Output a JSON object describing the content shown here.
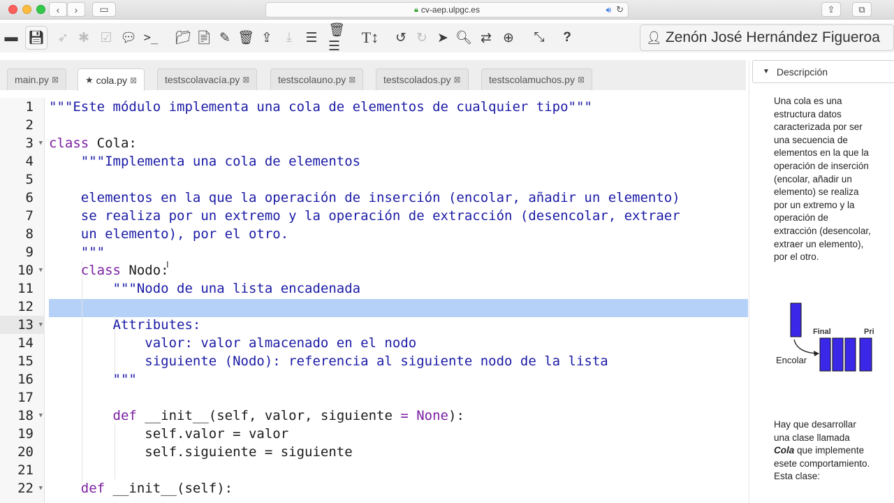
{
  "browser": {
    "url": "cv-aep.ulpgc.es"
  },
  "toolbar": {
    "user_name": "Zenón José Hernández Figueroa"
  },
  "tabs": [
    {
      "label": "main.py",
      "active": false
    },
    {
      "label": "cola.py",
      "active": true
    },
    {
      "label": "testscolavacía.py",
      "active": false
    },
    {
      "label": "testscolauno.py",
      "active": false
    },
    {
      "label": "testscolados.py",
      "active": false
    },
    {
      "label": "testscolamuchos.py",
      "active": false
    }
  ],
  "editor": {
    "line_numbers": [
      "1",
      "2",
      "3",
      "4",
      "5",
      "6",
      "7",
      "8",
      "9",
      "10",
      "11",
      "12",
      "13",
      "14",
      "15",
      "16",
      "17",
      "18",
      "19",
      "20",
      "21",
      "22"
    ],
    "lines": {
      "l1": "\"\"\"Este módulo implementa una cola de elementos de cualquier tipo\"\"\"",
      "l3_kw": "class",
      "l3_name": " Cola:",
      "l4": "    \"\"\"Implementa una cola de elementos",
      "l6": "    elementos en la que la operación de inserción (encolar, añadir un elemento)",
      "l7": "    se realiza por un extremo y la operación de extracción (desencolar, extraer",
      "l8": "    un elemento), por el otro.",
      "l9": "    \"\"\"",
      "l10_kw": "    class",
      "l10_name": " Nodo:",
      "l11": "        \"\"\"Nodo de una lista encadenada",
      "l13": "        Attributes:",
      "l14": "            valor: valor almacenado en el nodo",
      "l15": "            siguiente (Nodo): referencia al siguiente nodo de la lista",
      "l16": "        \"\"\"",
      "l18_kw": "        def",
      "l18_a": " __init__(self, valor, siguiente ",
      "l18_eq": "=",
      "l18_none": " None",
      "l18_b": "):",
      "l19": "            self.valor = valor",
      "l20": "            self.siguiente = siguiente",
      "l22_kw": "    def",
      "l22_a": " __init__(self):"
    }
  },
  "description": {
    "header": "Descripción",
    "para1": "Una cola es una estructura datos caracterizada por ser una secuencia de elementos en la que la operación de inserción (encolar, añadir un elemento) se realiza por un extremo y la operación de extracción (desencolar, extraer un elemento), por el otro.",
    "figure_labels": {
      "final": "Final",
      "pri": "Pri",
      "encolar": "Encolar"
    },
    "para2_a": "Hay que desarrollar una clase llamada ",
    "para2_b": "Cola",
    "para2_c": " que implemente esete comportamiento. Esta clase:"
  },
  "colors": {
    "accent_selection": "#b5d1f7",
    "keyword": "#7b1fa2",
    "string": "#1a1aa6",
    "figure_block": "#3b27e8"
  }
}
